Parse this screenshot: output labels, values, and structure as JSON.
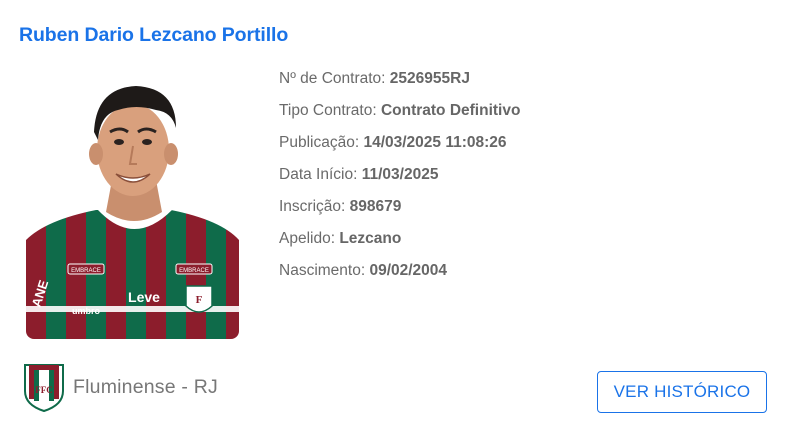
{
  "player": {
    "name": "Ruben Dario Lezcano Portillo",
    "photo": {
      "shirt_colors": [
        "#8c1d2c",
        "#0f6b4a",
        "#ffffff"
      ],
      "sponsor_left": "EMBRACE",
      "sponsor_right": "EMBRACE",
      "brand": "umbro",
      "chest_sponsor": "Leve",
      "sleeve_text": "ANE"
    }
  },
  "details": [
    {
      "label": "Nº de Contrato: ",
      "value": "2526955RJ"
    },
    {
      "label": "Tipo Contrato: ",
      "value": "Contrato Definitivo"
    },
    {
      "label": "Publicação: ",
      "value": "14/03/2025 11:08:26"
    },
    {
      "label": "Data Início: ",
      "value": "11/03/2025"
    },
    {
      "label": "Inscrição: ",
      "value": "898679"
    },
    {
      "label": "Apelido: ",
      "value": "Lezcano"
    },
    {
      "label": "Nascimento: ",
      "value": "09/02/2004"
    }
  ],
  "club": {
    "name": "Fluminense - RJ",
    "crest_icon": "fluminense-crest-icon",
    "crest_letters": "FFC"
  },
  "actions": {
    "history_label": "VER HISTÓRICO"
  },
  "colors": {
    "accent": "#1a73e8",
    "label_text": "#6a6a6a",
    "club_maroon": "#8c1d2c",
    "club_green": "#0f6b4a"
  }
}
